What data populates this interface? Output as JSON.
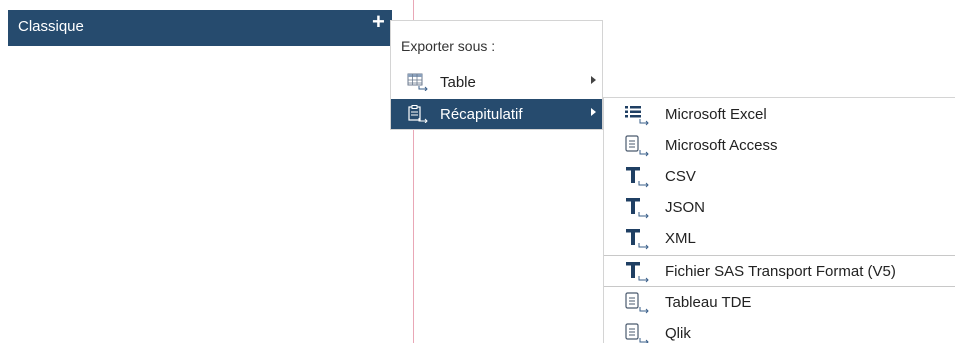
{
  "header": {
    "title": "Classique",
    "add_icon": "plus-icon"
  },
  "menu": {
    "heading": "Exporter sous :",
    "items": [
      {
        "label": "Table",
        "icon": "table-export-icon",
        "has_submenu": true,
        "selected": false
      },
      {
        "label": "Récapitulatif",
        "icon": "summary-export-icon",
        "has_submenu": true,
        "selected": true
      }
    ]
  },
  "submenu": {
    "items": [
      {
        "label": "Microsoft Excel",
        "icon": "list-export-icon"
      },
      {
        "label": "Microsoft Access",
        "icon": "document-export-icon"
      },
      {
        "label": "CSV",
        "icon": "text-export-icon"
      },
      {
        "label": "JSON",
        "icon": "text-export-icon"
      },
      {
        "label": "XML",
        "icon": "text-export-icon"
      },
      {
        "label": "Fichier SAS Transport Format (V5)",
        "icon": "text-export-icon"
      },
      {
        "label": "Tableau TDE",
        "icon": "document-export-icon"
      },
      {
        "label": "Qlik",
        "icon": "document-export-icon"
      }
    ]
  },
  "colors": {
    "accent": "#264b6e",
    "divider": "#e9a7b6"
  }
}
